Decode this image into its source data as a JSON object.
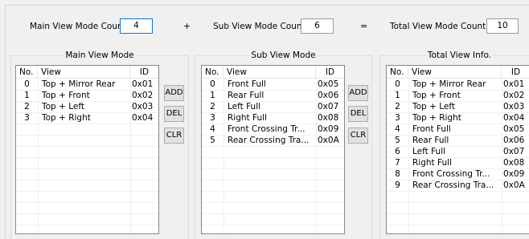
{
  "top": {
    "main_label": "Main View Mode Count",
    "main_value": "4",
    "plus": "+",
    "sub_label": "Sub View Mode Count",
    "sub_value": "6",
    "equals": "=",
    "total_label": "Total View Mode Count",
    "total_value": "10"
  },
  "main_group": {
    "title": "Main View Mode",
    "columns": [
      "No.",
      "View",
      "ID"
    ],
    "rows": [
      [
        "0",
        "Top + Mirror Rear",
        "0x01"
      ],
      [
        "1",
        "Top + Front",
        "0x02"
      ],
      [
        "2",
        "Top + Left",
        "0x03"
      ],
      [
        "3",
        "Top + Right",
        "0x04"
      ]
    ]
  },
  "sub_group": {
    "title": "Sub View Mode",
    "columns": [
      "No.",
      "View",
      "ID"
    ],
    "rows": [
      [
        "0",
        "Front Full",
        "0x05"
      ],
      [
        "1",
        "Rear Full",
        "0x06"
      ],
      [
        "2",
        "Left Full",
        "0x07"
      ],
      [
        "3",
        "Right Full",
        "0x08"
      ],
      [
        "4",
        "Front Crossing Tr...",
        "0x09"
      ],
      [
        "5",
        "Rear Crossing Tra...",
        "0x0A"
      ]
    ]
  },
  "total_group": {
    "title": "Total View Info.",
    "columns": [
      "No.",
      "View",
      "ID"
    ],
    "rows": [
      [
        "0",
        "Top + Mirror Rear",
        "0x01"
      ],
      [
        "1",
        "Top + Front",
        "0x02"
      ],
      [
        "2",
        "Top + Left",
        "0x03"
      ],
      [
        "3",
        "Top + Right",
        "0x04"
      ],
      [
        "4",
        "Front Full",
        "0x05"
      ],
      [
        "5",
        "Rear Full",
        "0x06"
      ],
      [
        "6",
        "Left Full",
        "0x07"
      ],
      [
        "7",
        "Right Full",
        "0x08"
      ],
      [
        "8",
        "Front Crossing Tr...",
        "0x09"
      ],
      [
        "9",
        "Rear Crossing Tra...",
        "0x0A"
      ]
    ]
  },
  "buttons": {
    "add": "ADD",
    "del": "DEL",
    "clr": "CLR"
  }
}
